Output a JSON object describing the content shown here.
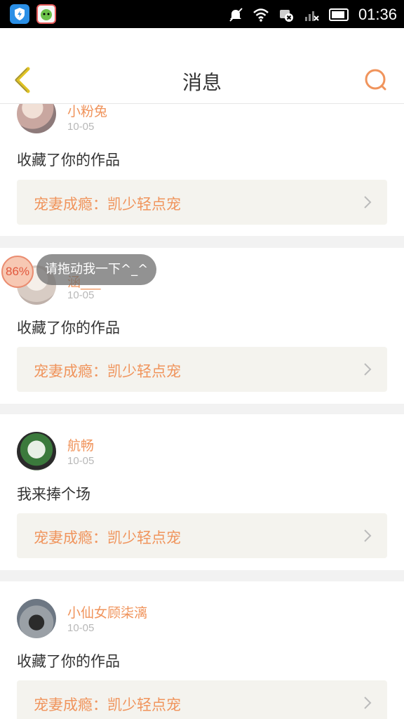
{
  "status_bar": {
    "time": "01:36",
    "icons": [
      "shield-app-icon",
      "game-app-icon",
      "mute-icon",
      "wifi-icon",
      "data-off-icon",
      "signal-icon",
      "battery-icon"
    ]
  },
  "nav": {
    "title": "消息",
    "back_icon": "chevron-left-icon",
    "search_icon": "search-icon"
  },
  "colors": {
    "accent": "#f0945c",
    "back": "#e0c323"
  },
  "messages": [
    {
      "username": "小粉兔",
      "date": "10-05",
      "text": "收藏了你的作品",
      "work": "宠妻成瘾：凯少轻点宠"
    },
    {
      "username": "涵___",
      "date": "10-05",
      "text": "收藏了你的作品",
      "work": "宠妻成瘾：凯少轻点宠"
    },
    {
      "username": "航畅",
      "date": "10-05",
      "text": "我来捧个场",
      "work": "宠妻成瘾：凯少轻点宠"
    },
    {
      "username": "小仙女顾柒漓",
      "date": "10-05",
      "text": "收藏了你的作品",
      "work": "宠妻成瘾：凯少轻点宠"
    }
  ],
  "float_widget": {
    "percent": "86%",
    "tip": "请拖动我一下^_^"
  }
}
